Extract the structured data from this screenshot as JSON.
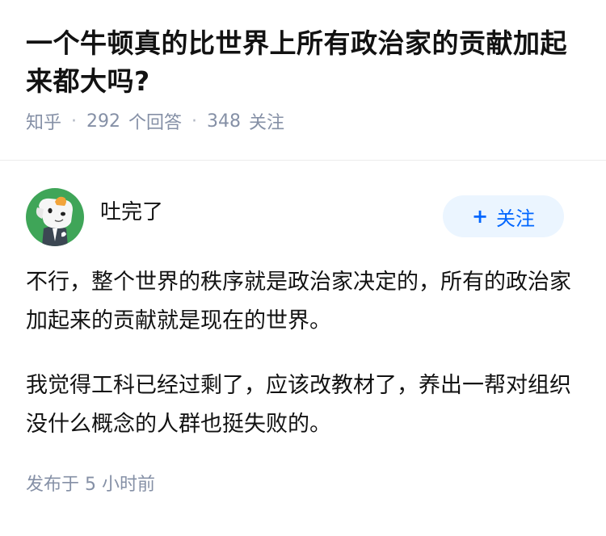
{
  "question": {
    "title": "一个牛顿真的比世界上所有政治家的贡献加起来都大吗?",
    "source": "知乎",
    "answer_count": "292",
    "answer_label": "个回答",
    "follower_count": "348",
    "follower_label": "关注"
  },
  "answer": {
    "author_name": "吐完了",
    "follow_label": "关注",
    "paragraphs": [
      "不行，整个世界的秩序就是政治家决定的，所有的政治家加起来的贡献就是现在的世界。",
      "我觉得工科已经过剩了，应该改教材了，养出一帮对组织没什么概念的人群也挺失败的。"
    ],
    "time": "发布于 5 小时前"
  },
  "colors": {
    "accent": "#0066ff",
    "follow_bg": "#ebf5ff",
    "meta": "#8590a6",
    "avatar_bg": "#3fa558"
  }
}
